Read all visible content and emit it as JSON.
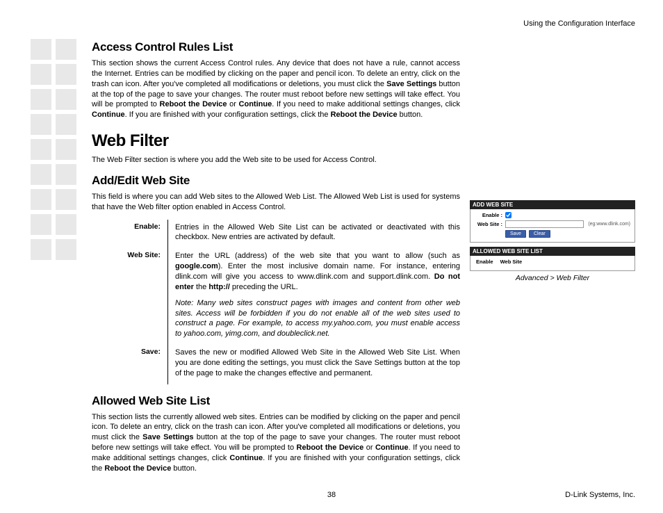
{
  "header": {
    "right": "Using the Configuration Interface"
  },
  "s1": {
    "title": "Access Control Rules List",
    "p_a": "This section shows the current Access Control rules. Any device that does not have a rule, cannot access the Internet. Entries can be modified by clicking on the paper and pencil icon. To delete an entry, click on the trash can icon. After you've completed all modifications or deletions, you must click the ",
    "b1": "Save Settings",
    "p_b": " button at the top of the page to save your changes. The router must reboot before new settings will take effect. You will be prompted to ",
    "b2": "Reboot the Device",
    "p_c": " or ",
    "b3": "Continue",
    "p_d": ". If you need to make additional settings changes, click ",
    "b4": "Continue",
    "p_e": ". If you are finished with your configuration settings, click the ",
    "b5": "Reboot the Device",
    "p_f": " button."
  },
  "s2": {
    "title": "Web Filter",
    "p": "The Web Filter section is where you add the Web site to be used for Access Control."
  },
  "s3": {
    "title": "Add/Edit Web Site",
    "p": "This field is where you can add Web sites to the Allowed Web List. The Allowed Web List is used for systems that have the Web filter option enabled in Access Control.",
    "defs": {
      "enable": {
        "label": "Enable:",
        "text": "Entries in the Allowed Web Site List can be activated or deactivated with this checkbox. New entries are activated by default."
      },
      "website": {
        "label": "Web Site:",
        "t1": "Enter the URL (address) of the web site that you want to allow (such as ",
        "b1": "google.com",
        "t2": "). Enter the most inclusive domain name. For instance, entering dlink.com will give you access to www.dlink.com and support.dlink.com. ",
        "b2": "Do not enter",
        "t3": " the ",
        "b3": "http://",
        "t4": " preceding the URL.",
        "note": "Note: Many web sites construct pages with images and content from other web sites. Access will be forbidden if you do not enable all of the web sites used to construct a page. For example, to access my.yahoo.com, you must enable access to yahoo.com, yimg.com, and doubleclick.net."
      },
      "save": {
        "label": "Save:",
        "text": "Saves the new or modified Allowed Web Site in the Allowed Web Site List. When you are done editing the settings, you must click the Save Settings button at the top of the page to make the changes effective and permanent."
      }
    }
  },
  "s4": {
    "title": "Allowed Web Site List",
    "p_a": "This section lists the currently allowed web sites. Entries can be modified by clicking on the paper and pencil icon. To delete an entry, click on the trash can icon. After you've completed all modifications or deletions, you must click the ",
    "b1": "Save Settings",
    "p_b": " button at the top of the page to save your changes. The router must reboot before new settings will take effect. You will be prompted to ",
    "b2": "Reboot the Device",
    "p_c": " or ",
    "b3": "Continue",
    "p_d": ". If you need to make additional settings changes, click ",
    "b4": "Continue",
    "p_e": ". If you are finished with your configuration settings, click the ",
    "b5": "Reboot the Device",
    "p_f": " button."
  },
  "screenshot": {
    "panel1_title": "ADD WEB SITE",
    "enable_label": "Enable :",
    "website_label": "Web Site :",
    "eg": "(eg:www.dlink.com)",
    "save_btn": "Save",
    "clear_btn": "Clear",
    "panel2_title": "ALLOWED WEB SITE LIST",
    "col1": "Enable",
    "col2": "Web Site",
    "caption": "Advanced > Web Filter"
  },
  "footer": {
    "page": "38",
    "company": "D-Link Systems, Inc."
  }
}
